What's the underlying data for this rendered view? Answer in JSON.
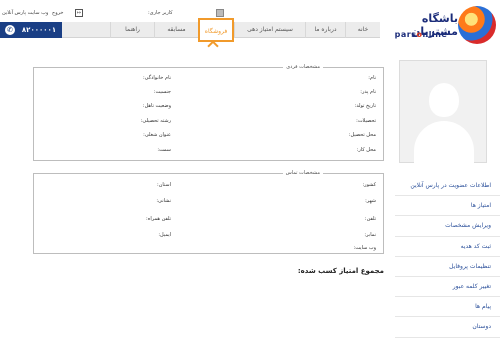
{
  "topbar": {
    "user_label": "کاربر جاری:",
    "exit_label": "خروج",
    "site_label": "وب سایت پارس آنلاین"
  },
  "logo": {
    "fa": "باشگاه مشتریان",
    "en_a": "pars",
    "en_b": "o",
    "en_c": "nline"
  },
  "nav": {
    "items": [
      "خانه",
      "درباره ما",
      "سیستم امتیاز دهی",
      "فروشگاه",
      "مسابقه",
      "راهنما"
    ],
    "active_index": 3
  },
  "phone": {
    "number": "۸۲۰۰۰۰۰۱"
  },
  "sidebar": {
    "items": [
      "اطلاعات عضویت در پارس آنلاین",
      "امتیاز ها",
      "ویرایش مشخصات",
      "ثبت کد هدیه",
      "تنظیمات پروفایل",
      "تغییر کلمه عبور",
      "پیام ها",
      "دوستان"
    ]
  },
  "personal": {
    "legend": "مشخصات فردی",
    "name": "نام:",
    "family": "نام خانوادگی:",
    "father": "نام پدر:",
    "gender": "جنسیت:",
    "birth": "تاریخ تولد:",
    "marital": "وضعیت تاهل:",
    "education": "تحصیلات:",
    "field": "رشته تحصیلی:",
    "study_place": "محل تحصیل:",
    "job_title": "عنوان شغلی:",
    "work_place": "محل کار:",
    "position": "سمت:"
  },
  "contact": {
    "legend": "مشخصات تماس",
    "country": "کشور:",
    "province": "استان:",
    "city": "شهر:",
    "address": "نشانی:",
    "phone": "تلفن:",
    "mobile": "تلفن همراه:",
    "fax": "نمابر:",
    "email": "ایمیل:",
    "website": "وب سایت:"
  },
  "score": {
    "title": "مجموع امتیاز کسب شده:"
  }
}
